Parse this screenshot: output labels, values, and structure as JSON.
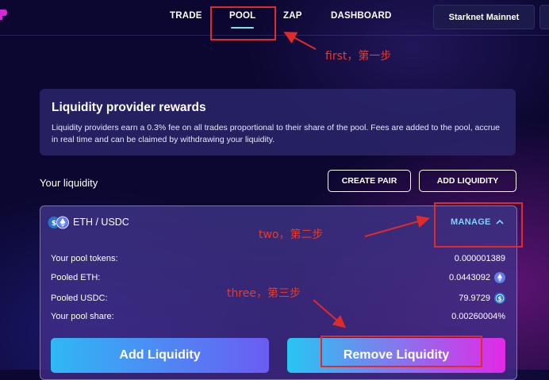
{
  "nav": {
    "items": [
      {
        "label": "TRADE"
      },
      {
        "label": "POOL"
      },
      {
        "label": "ZAP"
      },
      {
        "label": "DASHBOARD"
      }
    ],
    "network_button": "Starknet Mainnet"
  },
  "info_card": {
    "title": "Liquidity provider rewards",
    "text": "Liquidity providers earn a 0.3% fee on all trades proportional to their share of the pool. Fees are added to the pool, accrue in real time and can be claimed by withdrawing your liquidity."
  },
  "liquidity_section": {
    "heading": "Your liquidity",
    "create_pair_label": "CREATE PAIR",
    "add_liquidity_label": "ADD LIQUIDITY"
  },
  "pool": {
    "pair": "ETH / USDC",
    "manage_label": "MANAGE",
    "rows": [
      {
        "label": "Your pool tokens:",
        "value": "0.000001389"
      },
      {
        "label": "Pooled ETH:",
        "value": "0.0443092",
        "icon": "eth-icon"
      },
      {
        "label": "Pooled USDC:",
        "value": "79.9729",
        "icon": "usdc-icon"
      },
      {
        "label": "Your pool share:",
        "value": "0.00260004%"
      }
    ],
    "add_button": "Add Liquidity",
    "remove_button": "Remove Liquidity"
  },
  "annotations": {
    "first": "first，第一步",
    "two": "two，第二步",
    "three": "three，第三步",
    "color": "#e02b2b"
  },
  "colors": {
    "background": "#0b0730",
    "accent_cyan": "#7fd3ff",
    "add_gradient": [
      "#2fb8f5",
      "#6b5cf2"
    ],
    "remove_gradient": [
      "#27c6f2",
      "#e229e6"
    ]
  }
}
